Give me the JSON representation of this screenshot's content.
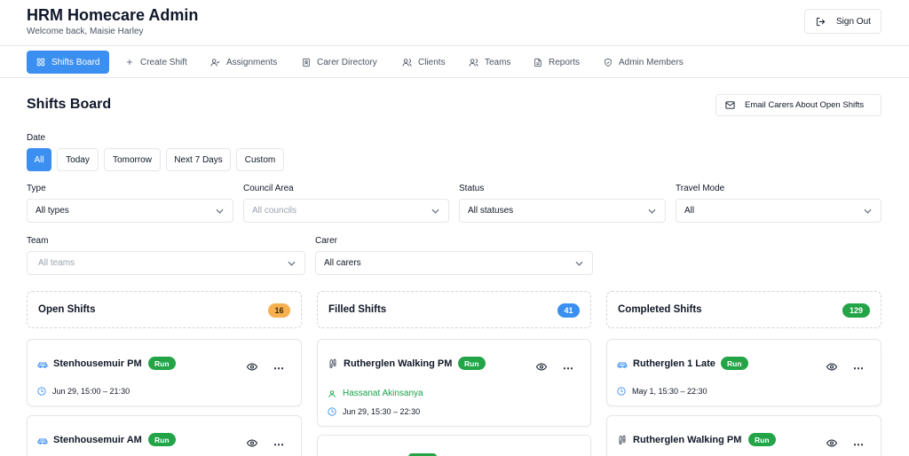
{
  "header": {
    "title": "HRM Homecare Admin",
    "welcome": "Welcome back, Maisie Harley",
    "sign_out": "Sign Out"
  },
  "nav": {
    "items": [
      {
        "label": "Shifts Board",
        "icon": "grid-icon",
        "active": true
      },
      {
        "label": "Create Shift",
        "icon": "plus-icon"
      },
      {
        "label": "Assignments",
        "icon": "user-check-icon"
      },
      {
        "label": "Carer Directory",
        "icon": "contact-card-icon"
      },
      {
        "label": "Clients",
        "icon": "users-icon"
      },
      {
        "label": "Teams",
        "icon": "users-icon"
      },
      {
        "label": "Reports",
        "icon": "document-icon"
      },
      {
        "label": "Admin Members",
        "icon": "shield-icon"
      }
    ]
  },
  "page": {
    "title": "Shifts Board",
    "email_button": "Email Carers About Open Shifts"
  },
  "filters": {
    "date_label": "Date",
    "date_options": [
      "All",
      "Today",
      "Tomorrow",
      "Next 7 Days",
      "Custom"
    ],
    "date_selected": "All",
    "type": {
      "label": "Type",
      "value": "All types"
    },
    "council": {
      "label": "Council Area",
      "placeholder": "All councils"
    },
    "status": {
      "label": "Status",
      "value": "All statuses"
    },
    "travel": {
      "label": "Travel Mode",
      "value": "All"
    },
    "team": {
      "label": "Team",
      "placeholder": "All teams"
    },
    "carer": {
      "label": "Carer",
      "value": "All carers"
    }
  },
  "columns": [
    {
      "title": "Open Shifts",
      "count": "16",
      "badge_color": "#f6b04f",
      "badge_text_color": "#3b2a05"
    },
    {
      "title": "Filled Shifts",
      "count": "41",
      "badge_color": "#3b8ff0",
      "badge_text_color": "#ffffff"
    },
    {
      "title": "Completed Shifts",
      "count": "129",
      "badge_color": "#22a447",
      "badge_text_color": "#ffffff"
    }
  ],
  "cards": {
    "open": [
      {
        "name": "Stenhousemuir PM",
        "mode_icon": "car-icon",
        "badge": "Run",
        "time": "Jun 29, 15:00 – 21:30"
      },
      {
        "name": "Stenhousemuir AM",
        "mode_icon": "car-icon",
        "badge": "Run"
      }
    ],
    "filled": [
      {
        "name": "Rutherglen Walking PM",
        "mode_icon": "footprints-icon",
        "badge": "Run",
        "carer": "Hassanat Akinsanya",
        "time": "Jun 29, 15:30 – 22:30"
      }
    ],
    "completed": [
      {
        "name": "Rutherglen 1 Late",
        "mode_icon": "car-icon",
        "badge": "Run",
        "time": "May 1, 15:30 – 22:30"
      },
      {
        "name": "Rutherglen Walking PM",
        "mode_icon": "footprints-icon",
        "badge": "Run"
      }
    ]
  },
  "colors": {
    "accent": "#3b8ff0",
    "run_badge": "#22a447",
    "carer_text": "#16a34a"
  }
}
